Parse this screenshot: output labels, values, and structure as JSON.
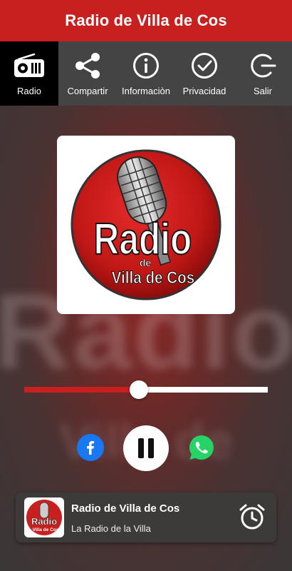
{
  "app": {
    "title": "Radio de Villa de Cos"
  },
  "nav": {
    "items": [
      {
        "label": "Radio",
        "icon": "radio-icon",
        "active": true
      },
      {
        "label": "Compartir",
        "icon": "share-icon",
        "active": false
      },
      {
        "label": "Informaciòn",
        "icon": "info-icon",
        "active": false
      },
      {
        "label": "Privacidad",
        "icon": "check-circle-icon",
        "active": false
      },
      {
        "label": "Salir",
        "icon": "exit-icon",
        "active": false
      }
    ]
  },
  "artwork": {
    "line1": "Radio",
    "line2": "de",
    "line3": "Villa de Cos"
  },
  "player": {
    "progress": 0.47,
    "state": "playing",
    "share_targets": [
      "facebook-icon",
      "whatsapp-icon"
    ]
  },
  "now_playing": {
    "title": "Radio de Villa de Cos",
    "subtitle": "La Radio de la Villa",
    "thumb_line1": "Radio",
    "thumb_line2": "Villa de Cos"
  },
  "colors": {
    "brand_red": "#c8201f",
    "nav_bg": "#444444",
    "nav_active_bg": "#000000",
    "facebook_blue": "#1877f2",
    "whatsapp_green": "#25d366"
  }
}
